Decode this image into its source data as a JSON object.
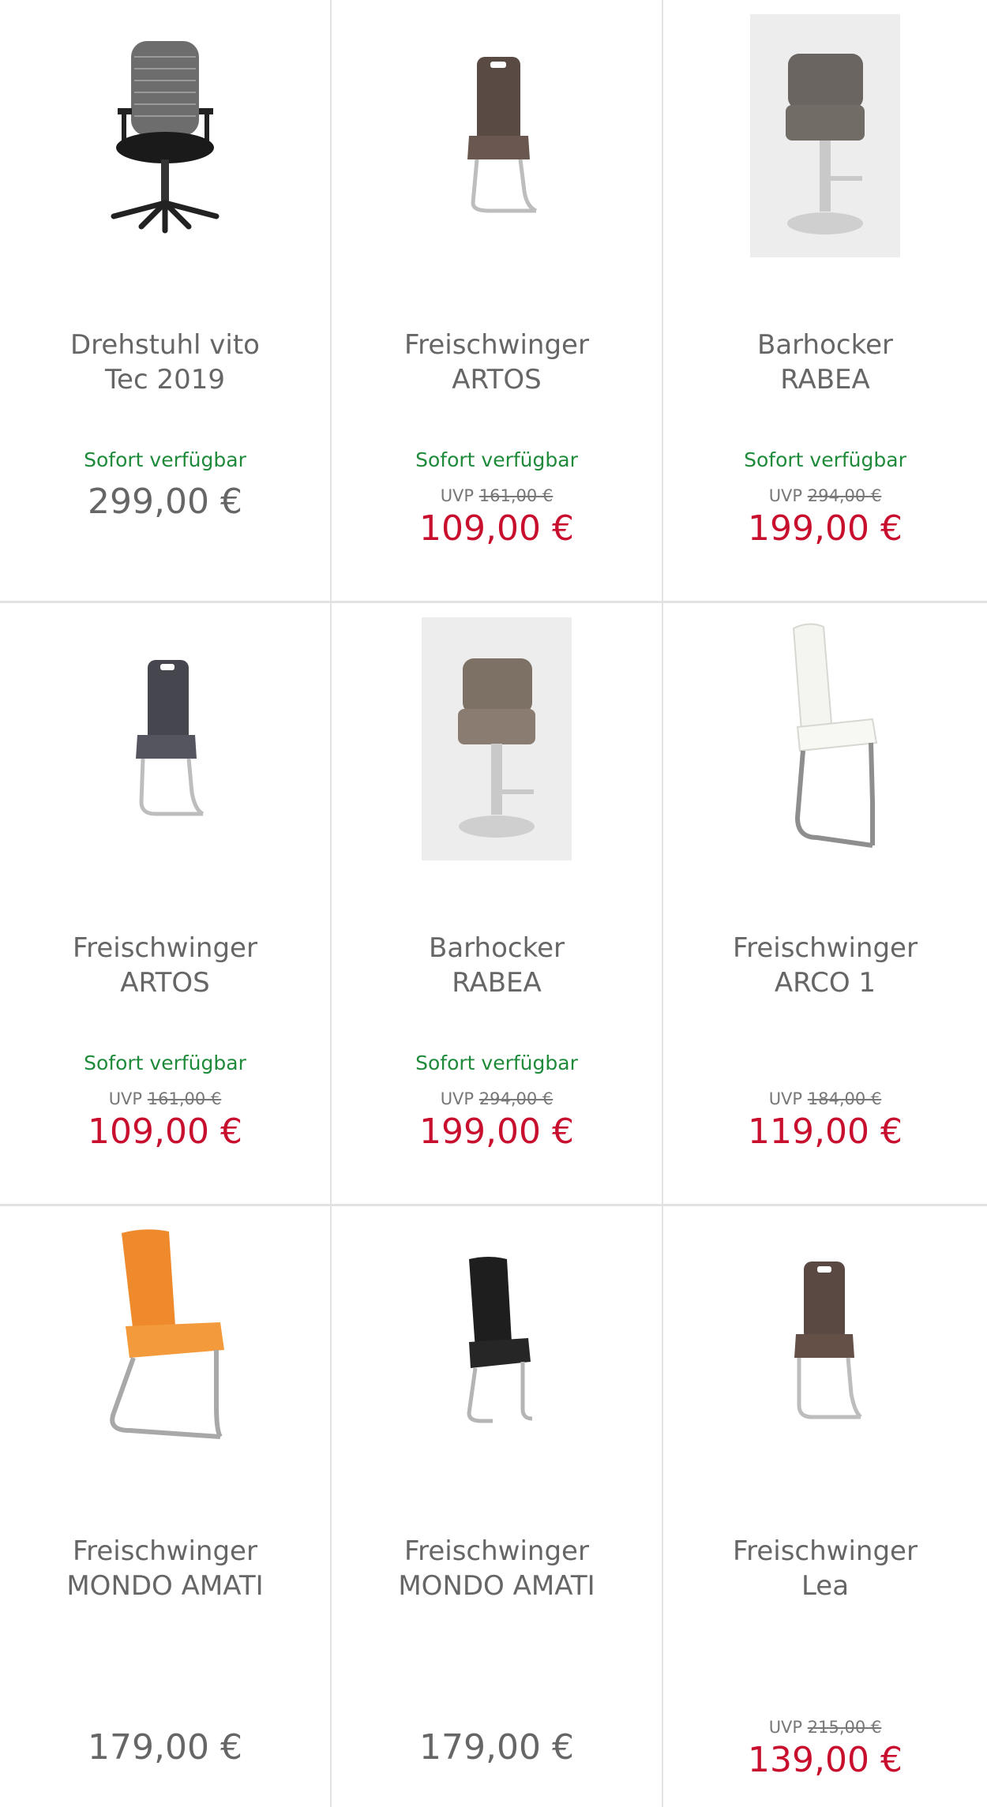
{
  "products": [
    {
      "name_line1": "Drehstuhl vito",
      "name_line2": "Tec 2019",
      "availability": "Sofort verfügbar",
      "uvp_label": "UVP",
      "uvp_price": "",
      "price": "299,00 €",
      "image_icon": "office-chair-icon"
    },
    {
      "name_line1": "Freischwinger",
      "name_line2": "ARTOS",
      "availability": "Sofort verfügbar",
      "uvp_label": "UVP",
      "uvp_price": "161,00 €",
      "price": "109,00 €",
      "image_icon": "cantilever-chair-brown-icon"
    },
    {
      "name_line1": "Barhocker",
      "name_line2": "RABEA",
      "availability": "Sofort verfügbar",
      "uvp_label": "UVP",
      "uvp_price": "294,00 €",
      "price": "199,00 €",
      "image_icon": "bar-stool-gray-icon"
    },
    {
      "name_line1": "Freischwinger",
      "name_line2": "ARTOS",
      "availability": "Sofort verfügbar",
      "uvp_label": "UVP",
      "uvp_price": "161,00 €",
      "price": "109,00 €",
      "image_icon": "cantilever-chair-gray-icon"
    },
    {
      "name_line1": "Barhocker",
      "name_line2": "RABEA",
      "availability": "Sofort verfügbar",
      "uvp_label": "UVP",
      "uvp_price": "294,00 €",
      "price": "199,00 €",
      "image_icon": "bar-stool-taupe-icon"
    },
    {
      "name_line1": "Freischwinger",
      "name_line2": "ARCO 1",
      "availability": "",
      "uvp_label": "UVP",
      "uvp_price": "184,00 €",
      "price": "119,00 €",
      "image_icon": "cantilever-chair-white-icon"
    },
    {
      "name_line1": "Freischwinger",
      "name_line2": "MONDO AMATI",
      "availability": "",
      "uvp_label": "",
      "uvp_price": "",
      "price": "179,00 €",
      "image_icon": "cantilever-chair-orange-icon"
    },
    {
      "name_line1": "Freischwinger",
      "name_line2": "MONDO AMATI",
      "availability": "",
      "uvp_label": "",
      "uvp_price": "",
      "price": "179,00 €",
      "image_icon": "cantilever-chair-black-icon"
    },
    {
      "name_line1": "Freischwinger",
      "name_line2": "Lea",
      "availability": "",
      "uvp_label": "UVP",
      "uvp_price": "215,00 €",
      "price": "139,00 €",
      "image_icon": "cantilever-chair-darkbrown-icon"
    }
  ],
  "colors": {
    "availability": "#1e8a3a",
    "sale_price": "#c8102e",
    "regular_price": "#666666",
    "divider": "#e2e2e2"
  }
}
